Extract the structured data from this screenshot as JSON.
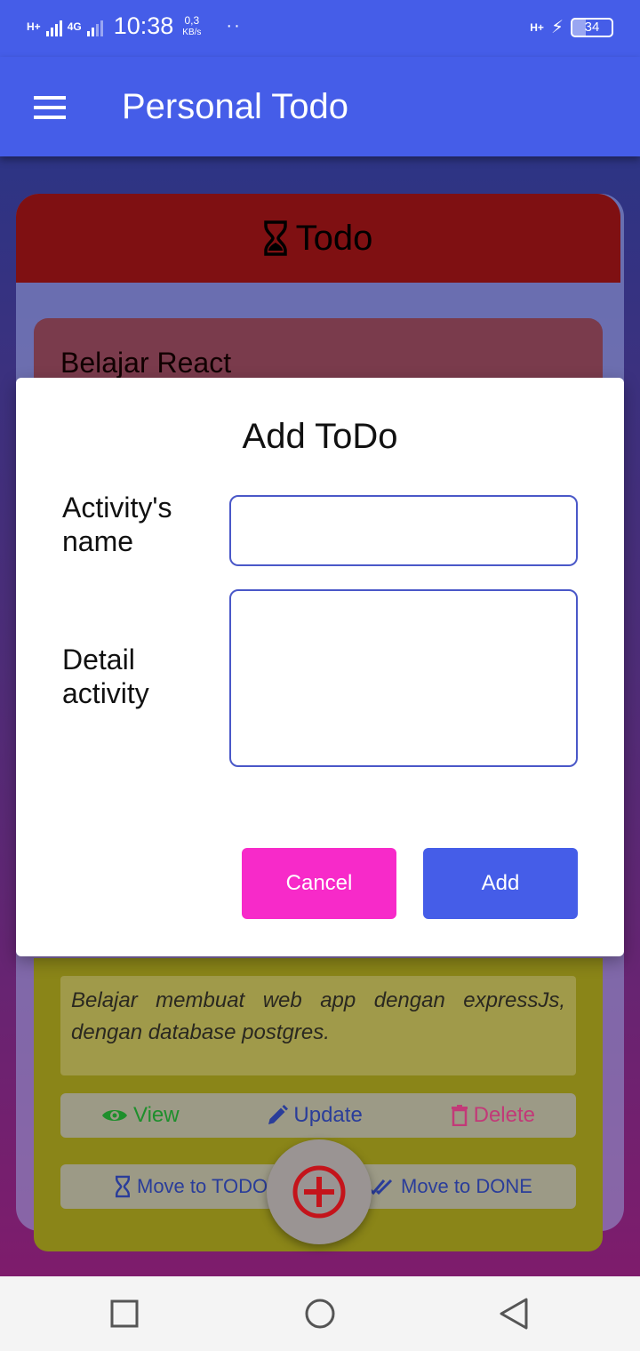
{
  "status_bar": {
    "network_type_1": "H+",
    "network_type_2": "4G",
    "time": "10:38",
    "speed_value": "0,3",
    "speed_unit": "KB/s",
    "dots": "··",
    "network_right": "H+",
    "battery_level": "34"
  },
  "app_bar": {
    "title": "Personal Todo"
  },
  "board": {
    "header_title": "Todo",
    "card_title": "Belajar React",
    "card_description": "Belajar membuat web app dengan expressJs, dengan database postgres.",
    "actions": {
      "view": "View",
      "update": "Update",
      "delete": "Delete"
    },
    "moves": {
      "todo": "Move to TODO",
      "done": "Move to DONE"
    }
  },
  "modal": {
    "title": "Add ToDo",
    "name_label": "Activity's name",
    "name_value": "",
    "detail_label": "Detail activity",
    "detail_value": "",
    "cancel_label": "Cancel",
    "add_label": "Add"
  },
  "colors": {
    "primary": "#455de8",
    "cancel": "#f72ac9",
    "todo_header": "#7f1012"
  }
}
